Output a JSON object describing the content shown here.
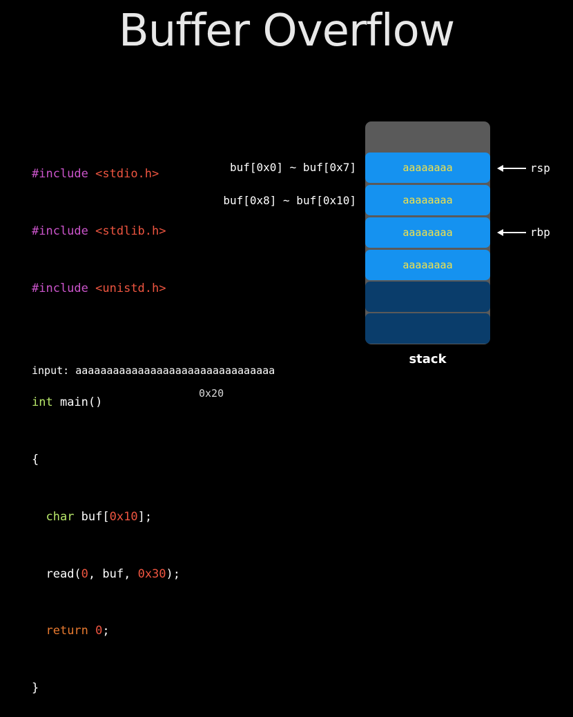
{
  "title": "Buffer Overflow",
  "code": {
    "inc1_kw": "#include",
    "inc1_hdr": "<stdio.h>",
    "inc2_kw": "#include",
    "inc2_hdr": "<stdlib.h>",
    "inc3_kw": "#include",
    "inc3_hdr": "<unistd.h>",
    "main_type": "int",
    "main_rest": " main()",
    "brace_open": "{",
    "decl_type": "char",
    "decl_mid": " buf[",
    "decl_num": "0x10",
    "decl_end": "];",
    "read_a": "read(",
    "read_n1": "0",
    "read_b": ", buf, ",
    "read_n2": "0x30",
    "read_c": ");",
    "ret_kw": "return",
    "ret_sp": " ",
    "ret_num": "0",
    "ret_end": ";",
    "brace_close": "}"
  },
  "buffer_labels": {
    "first": "buf[0x0] ~ buf[0x7]",
    "second": "buf[0x8] ~ buf[0x10]"
  },
  "stack": {
    "caption": "stack",
    "slots": [
      {
        "value": "aaaaaaaa"
      },
      {
        "value": "aaaaaaaa"
      },
      {
        "value": "aaaaaaaa"
      },
      {
        "value": "aaaaaaaa"
      },
      {
        "value": ""
      },
      {
        "value": ""
      }
    ],
    "colors": {
      "filled": "#1592f0",
      "empty": "#0a3d6b",
      "frame": "#5a5a5a",
      "text": "#f2e24a"
    }
  },
  "pointers": {
    "rsp": "rsp",
    "rbp": "rbp"
  },
  "input": {
    "label": "input:",
    "value": "aaaaaaaaaaaaaaaaaaaaaaaaaaaaaaaa"
  },
  "size_note": "0x20"
}
